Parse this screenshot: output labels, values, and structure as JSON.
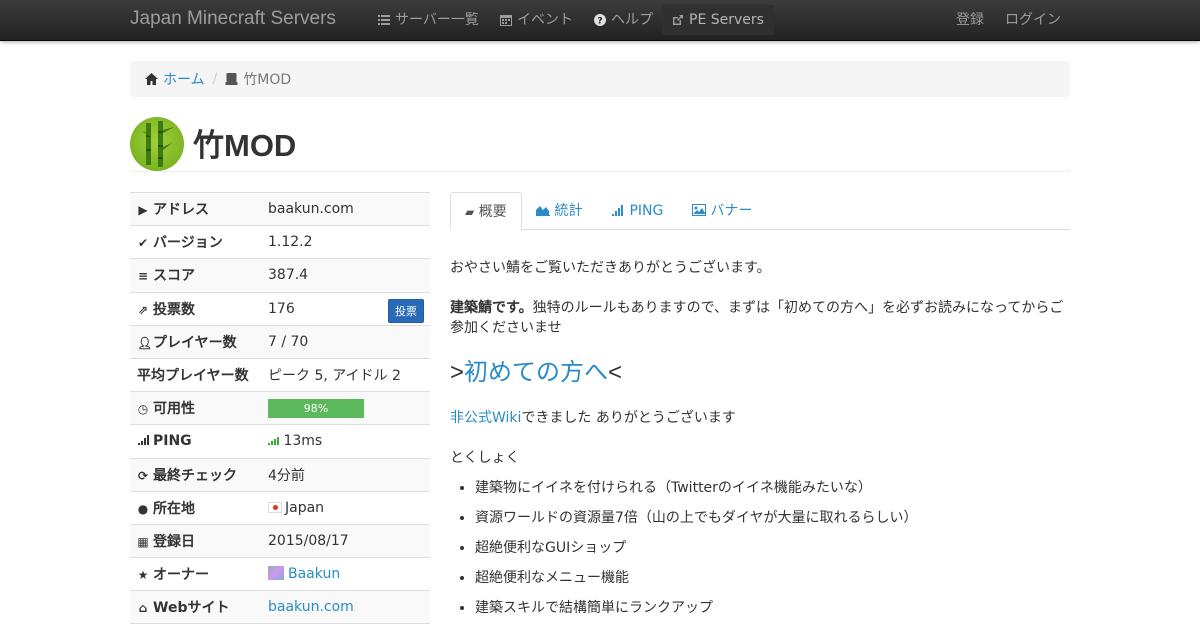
{
  "navbar": {
    "brand": "Japan Minecraft Servers",
    "items": [
      {
        "label": "サーバー一覧"
      },
      {
        "label": "イベント"
      },
      {
        "label": "ヘルプ"
      },
      {
        "label": "PE Servers"
      }
    ],
    "register": "登録",
    "login": "ログイン"
  },
  "breadcrumb": {
    "home": "ホーム",
    "current": "竹MOD"
  },
  "server": {
    "name": "竹MOD"
  },
  "info": {
    "address_label": "アドレス",
    "address": "baakun.com",
    "version_label": "バージョン",
    "version": "1.12.2",
    "score_label": "スコア",
    "score": "387.4",
    "votes_label": "投票数",
    "votes": "176",
    "vote_button": "投票",
    "players_label": "プレイヤー数",
    "players": "7 / 70",
    "avg_players_label": "平均プレイヤー数",
    "avg_players": "ピーク 5, アイドル 2",
    "availability_label": "可用性",
    "availability": "98%",
    "availability_value": 0.98,
    "ping_label": "PING",
    "ping": "13ms",
    "last_check_label": "最終チェック",
    "last_check": "4分前",
    "location_label": "所在地",
    "location": "Japan",
    "registered_label": "登録日",
    "registered": "2015/08/17",
    "owner_label": "オーナー",
    "owner": "Baakun",
    "website_label": "Webサイト",
    "website": "baakun.com"
  },
  "tabs": [
    {
      "label": "概要"
    },
    {
      "label": "統計"
    },
    {
      "label": "PING"
    },
    {
      "label": "バナー"
    }
  ],
  "content": {
    "p1": "おやさい鯖をご覧いただきありがとうございます。",
    "p2_bold": "建築鯖です。",
    "p2_rest": "独特のルールもありますので、まずは「初めての方へ」を必ずお読みになってからご参加くださいませ",
    "heading_pre": ">",
    "heading_link": "初めての方へ",
    "heading_post": "<",
    "wiki_link": "非公式Wiki",
    "wiki_rest": "できました ありがとうございます",
    "features_title": "とくしょく",
    "features": [
      "建築物にイイネを付けられる（Twitterのイイネ機能みたいな）",
      "資源ワールドの資源量7倍（山の上でもダイヤが大量に取れるらしい）",
      "超絶便利なGUIショップ",
      "超絶便利なメニュー機能",
      "建築スキルで結構簡単にランクアップ"
    ]
  }
}
